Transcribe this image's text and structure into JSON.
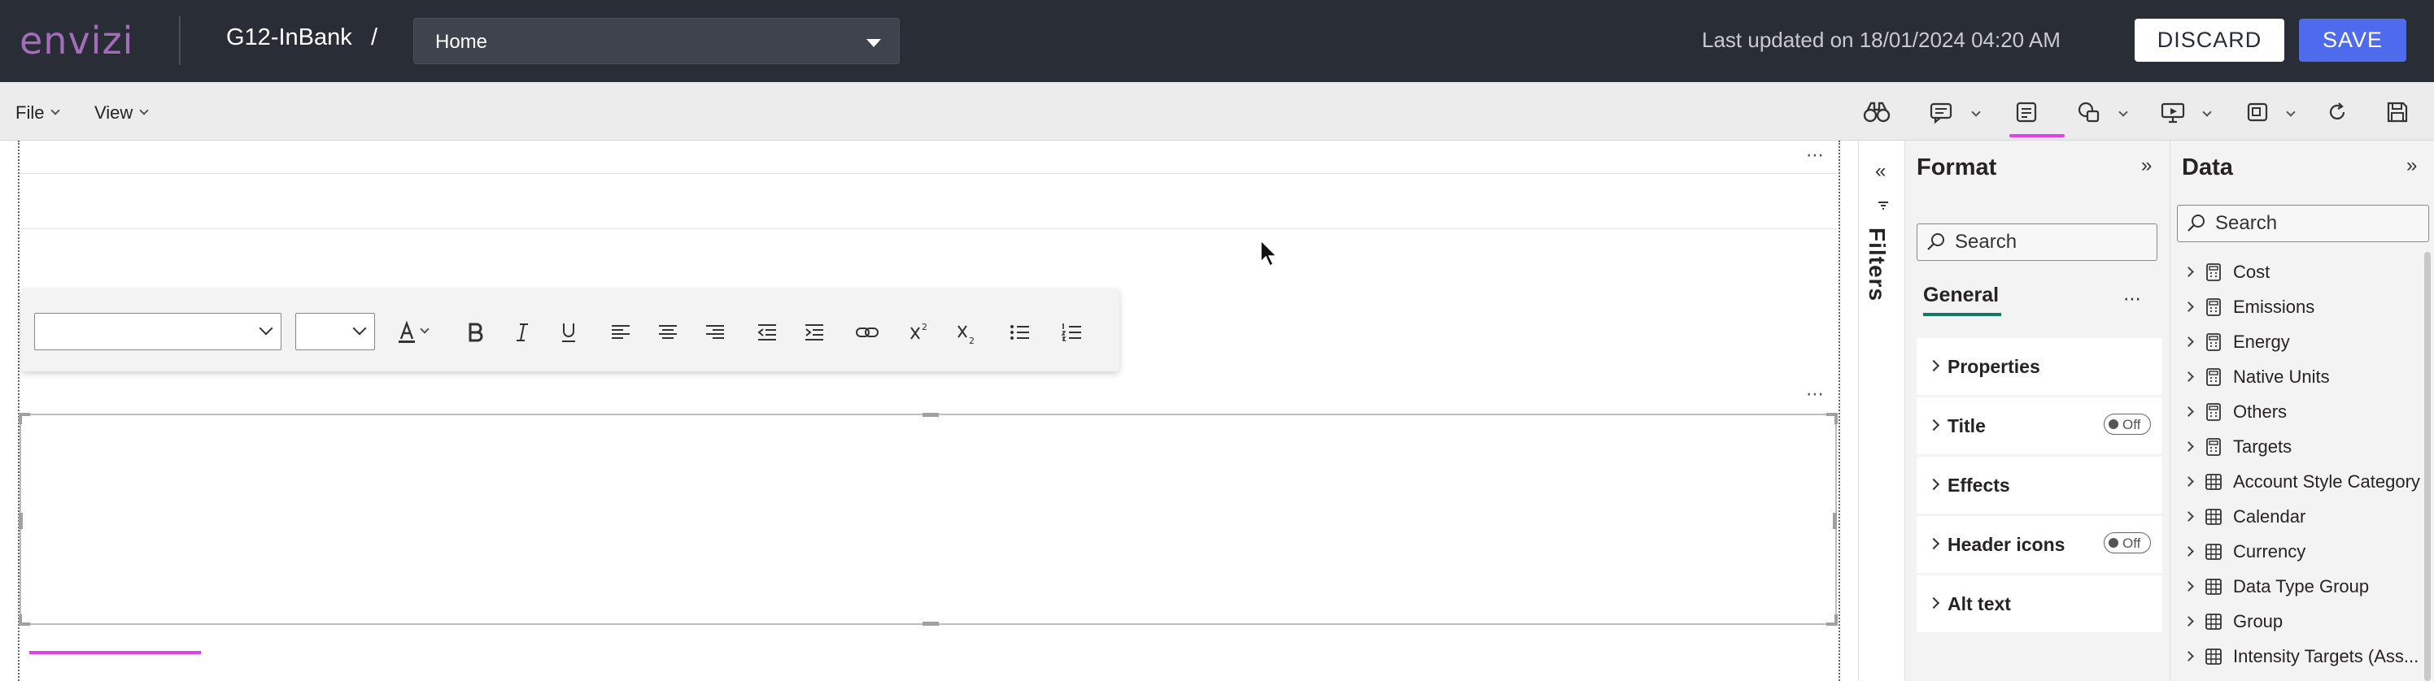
{
  "header": {
    "logo_text": "envizi",
    "workspace_title": "G12-InBank",
    "separator": "/",
    "page_select_value": "Home",
    "last_updated": "Last updated on 18/01/2024 04:20 AM",
    "discard_label": "DISCARD",
    "save_label": "SAVE"
  },
  "menubar": {
    "file_label": "File",
    "view_label": "View",
    "ribbon_icons": [
      "binoculars-icon",
      "comment-icon",
      "text-box-icon",
      "shapes-icon",
      "presentation-icon",
      "visual-container-icon",
      "refresh-icon",
      "save-icon"
    ],
    "active_ribbon_icon": "text-box-icon"
  },
  "filters": {
    "label": "Filters"
  },
  "format_pane": {
    "title": "Format",
    "search_placeholder": "Search",
    "tab_label": "General",
    "cards": [
      {
        "label": "Properties",
        "toggle": null
      },
      {
        "label": "Title",
        "toggle": "Off"
      },
      {
        "label": "Effects",
        "toggle": null
      },
      {
        "label": "Header icons",
        "toggle": "Off"
      },
      {
        "label": "Alt text",
        "toggle": null
      }
    ]
  },
  "data_pane": {
    "title": "Data",
    "search_placeholder": "Search",
    "items": [
      {
        "name": "Cost",
        "icon": "calculator-icon"
      },
      {
        "name": "Emissions",
        "icon": "calculator-icon"
      },
      {
        "name": "Energy",
        "icon": "calculator-icon"
      },
      {
        "name": "Native Units",
        "icon": "calculator-icon"
      },
      {
        "name": "Others",
        "icon": "calculator-icon"
      },
      {
        "name": "Targets",
        "icon": "calculator-icon"
      },
      {
        "name": "Account Style Category",
        "icon": "table-icon"
      },
      {
        "name": "Calendar",
        "icon": "table-icon"
      },
      {
        "name": "Currency",
        "icon": "table-icon"
      },
      {
        "name": "Data Type Group",
        "icon": "table-icon"
      },
      {
        "name": "Group",
        "icon": "table-icon"
      },
      {
        "name": "Intensity Targets (Ass...",
        "icon": "table-icon"
      }
    ]
  },
  "colors": {
    "header_bg": "#292d36",
    "brand_purple": "#a56cbb",
    "save_blue": "#4f6bed",
    "active_accent": "#e040e6",
    "general_tab_accent": "#117865"
  }
}
